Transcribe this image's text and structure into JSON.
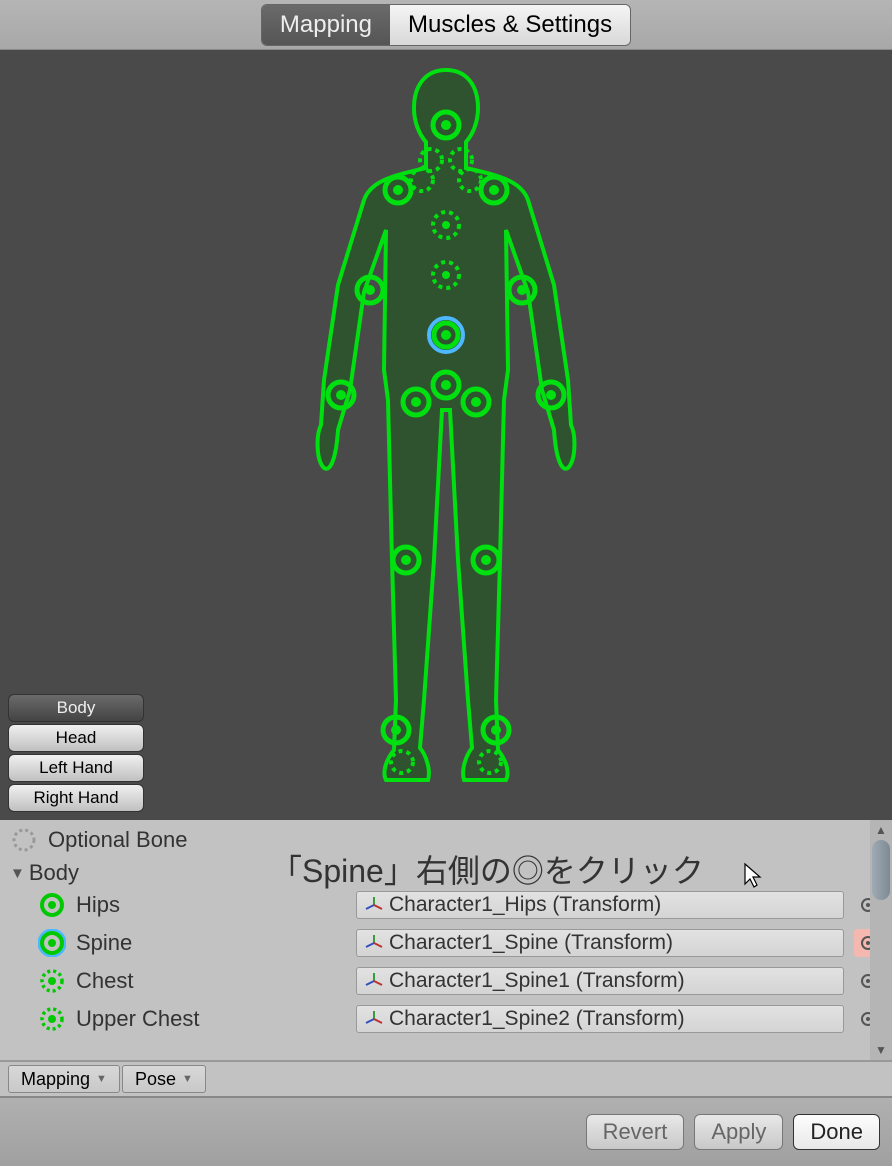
{
  "tabs": {
    "mapping": "Mapping",
    "muscles": "Muscles & Settings"
  },
  "parts": {
    "body": "Body",
    "head": "Head",
    "left_hand": "Left Hand",
    "right_hand": "Right Hand"
  },
  "optional_bone_label": "Optional Bone",
  "annotation": "「Spine」右側の◎をクリック",
  "body_heading": "Body",
  "bones": [
    {
      "name": "Hips",
      "value": "Character1_Hips (Transform)",
      "optional": false,
      "selected": false,
      "picker_hl": false
    },
    {
      "name": "Spine",
      "value": "Character1_Spine (Transform)",
      "optional": false,
      "selected": true,
      "picker_hl": true
    },
    {
      "name": "Chest",
      "value": "Character1_Spine1 (Transform)",
      "optional": true,
      "selected": false,
      "picker_hl": false
    },
    {
      "name": "Upper Chest",
      "value": "Character1_Spine2 (Transform)",
      "optional": true,
      "selected": false,
      "picker_hl": false
    }
  ],
  "dropdowns": {
    "mapping": "Mapping",
    "pose": "Pose"
  },
  "footer": {
    "revert": "Revert",
    "apply": "Apply",
    "done": "Done"
  },
  "colors": {
    "green": "#00e010",
    "dark_green": "#1a5a1a"
  }
}
